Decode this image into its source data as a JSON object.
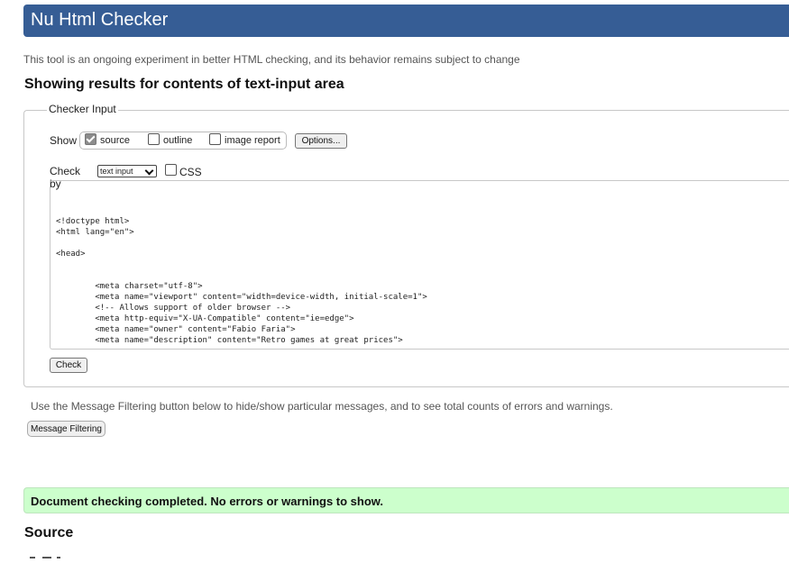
{
  "header": {
    "title": "Nu Html Checker"
  },
  "intro": "This tool is an ongoing experiment in better HTML checking, and its behavior remains subject to change",
  "results_heading": "Showing results for contents of text-input area",
  "checker_input": {
    "legend": "Checker Input",
    "show_label": "Show",
    "options": [
      {
        "label": "source",
        "checked": true
      },
      {
        "label": "outline",
        "checked": false
      },
      {
        "label": "image report",
        "checked": false
      }
    ],
    "options_button": "Options...",
    "check_by_label": "Check by",
    "check_by_value": "text input",
    "css_label": "CSS",
    "css_checked": false,
    "code_lines": [
      "<!doctype html>",
      "<html lang=\"en\">",
      "",
      "<head>",
      "",
      "",
      "        <meta charset=\"utf-8\">",
      "        <meta name=\"viewport\" content=\"width=device-width, initial-scale=1\">",
      "        <!-- Allows support of older browser -->",
      "        <meta http-equiv=\"X-UA-Compatible\" content=\"ie=edge\">",
      "        <meta name=\"owner\" content=\"Fabio Faria\">",
      "        <meta name=\"description\" content=\"Retro games at great prices\">"
    ],
    "check_button": "Check"
  },
  "filter_info": "Use the Message Filtering button below to hide/show particular messages, and to see total counts of errors and warnings.",
  "filter_button": "Message Filtering",
  "success_message": "Document checking completed. No errors or warnings to show.",
  "source_heading": "Source",
  "colors": {
    "header_bg": "#365d95",
    "success_bg": "#ccffcc"
  }
}
